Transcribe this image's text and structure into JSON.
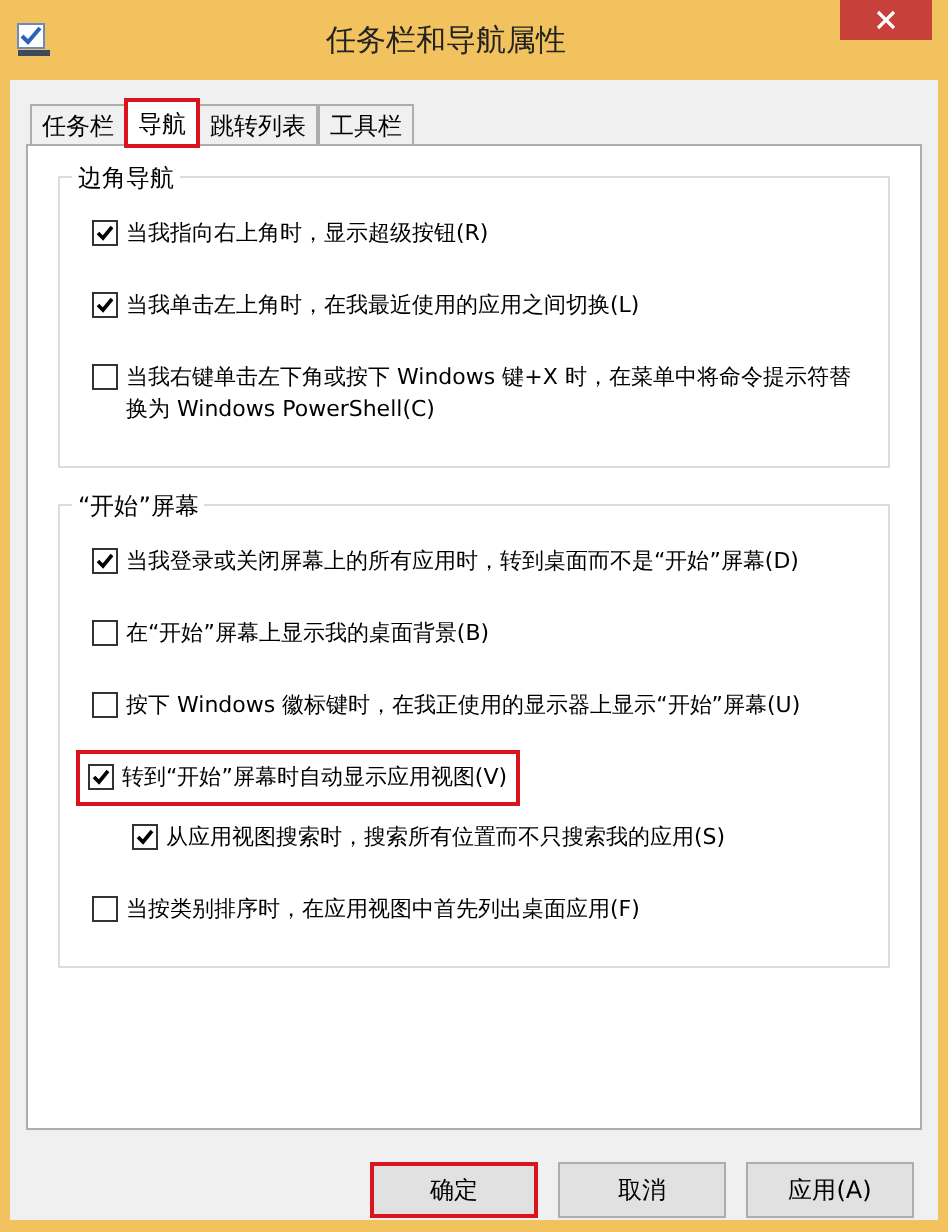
{
  "window": {
    "title": "任务栏和导航属性"
  },
  "tabs": [
    {
      "label": "任务栏",
      "selected": false,
      "highlighted": false
    },
    {
      "label": "导航",
      "selected": true,
      "highlighted": true
    },
    {
      "label": "跳转列表",
      "selected": false,
      "highlighted": false
    },
    {
      "label": "工具栏",
      "selected": false,
      "highlighted": false
    }
  ],
  "groups": [
    {
      "title": "边角导航",
      "options": [
        {
          "label": "当我指向右上角时，显示超级按钮(R)",
          "checked": true,
          "highlighted": false
        },
        {
          "label": "当我单击左上角时，在我最近使用的应用之间切换(L)",
          "checked": true,
          "highlighted": false
        },
        {
          "label": "当我右键单击左下角或按下 Windows 键+X 时，在菜单中将命令提示符替换为 Windows PowerShell(C)",
          "checked": false,
          "highlighted": false
        }
      ]
    },
    {
      "title": "“开始”屏幕",
      "options": [
        {
          "label": "当我登录或关闭屏幕上的所有应用时，转到桌面而不是“开始”屏幕(D)",
          "checked": true,
          "highlighted": false
        },
        {
          "label": "在“开始”屏幕上显示我的桌面背景(B)",
          "checked": false,
          "highlighted": false
        },
        {
          "label": "按下 Windows 徽标键时，在我正使用的显示器上显示“开始”屏幕(U)",
          "checked": false,
          "highlighted": false
        },
        {
          "label": "转到“开始”屏幕时自动显示应用视图(V)",
          "checked": true,
          "highlighted": true,
          "children": [
            {
              "label": "从应用视图搜索时，搜索所有位置而不只搜索我的应用(S)",
              "checked": true,
              "highlighted": false
            }
          ]
        },
        {
          "label": "当按类别排序时，在应用视图中首先列出桌面应用(F)",
          "checked": false,
          "highlighted": false
        }
      ]
    }
  ],
  "buttons": [
    {
      "label": "确定",
      "highlighted": true
    },
    {
      "label": "取消",
      "highlighted": false
    },
    {
      "label": "应用(A)",
      "highlighted": false
    }
  ]
}
